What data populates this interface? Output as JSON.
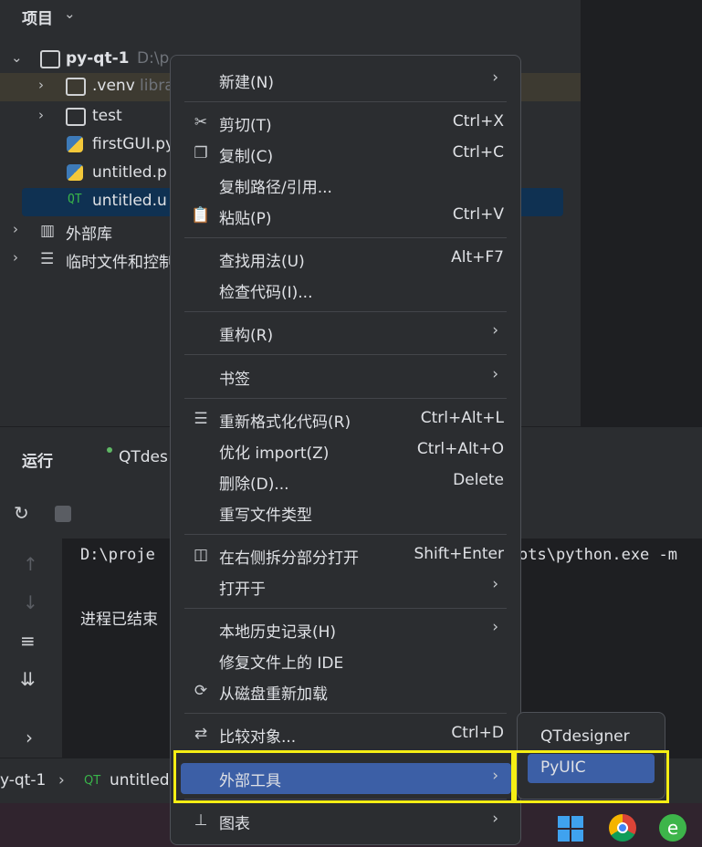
{
  "project_panel": {
    "title": "项目",
    "tree": [
      {
        "label": "py-qt-1",
        "hint": "D:\\p"
      },
      {
        "label": ".venv",
        "hint": "libra"
      },
      {
        "label": "test",
        "hint": ""
      },
      {
        "label": "firstGUI.py",
        "hint": ""
      },
      {
        "label": "untitled.p",
        "hint": ""
      },
      {
        "label": "untitled.u",
        "hint": ""
      },
      {
        "label": "外部库",
        "hint": ""
      },
      {
        "label": "临时文件和控制",
        "hint": ""
      }
    ]
  },
  "run_panel": {
    "title": "运行",
    "tab": "QTdes",
    "console_lines": [
      "D:\\proje",
      "ots\\python.exe -m",
      "进程已结束"
    ]
  },
  "status_bar": {
    "project": "y-qt-1",
    "file": "untitled"
  },
  "context_menu": {
    "items": [
      {
        "label": "新建(N)",
        "shortcut": "",
        "submenu": true
      },
      {
        "label": "剪切(T)",
        "shortcut": "Ctrl+X",
        "submenu": false
      },
      {
        "label": "复制(C)",
        "shortcut": "Ctrl+C",
        "submenu": false
      },
      {
        "label": "复制路径/引用...",
        "shortcut": "",
        "submenu": false
      },
      {
        "label": "粘贴(P)",
        "shortcut": "Ctrl+V",
        "submenu": false
      },
      {
        "label": "查找用法(U)",
        "shortcut": "Alt+F7",
        "submenu": false
      },
      {
        "label": "检查代码(I)...",
        "shortcut": "",
        "submenu": false
      },
      {
        "label": "重构(R)",
        "shortcut": "",
        "submenu": true
      },
      {
        "label": "书签",
        "shortcut": "",
        "submenu": true
      },
      {
        "label": "重新格式化代码(R)",
        "shortcut": "Ctrl+Alt+L",
        "submenu": false
      },
      {
        "label": "优化 import(Z)",
        "shortcut": "Ctrl+Alt+O",
        "submenu": false
      },
      {
        "label": "删除(D)...",
        "shortcut": "Delete",
        "submenu": false
      },
      {
        "label": "重写文件类型",
        "shortcut": "",
        "submenu": false
      },
      {
        "label": "在右侧拆分部分打开",
        "shortcut": "Shift+Enter",
        "submenu": false
      },
      {
        "label": "打开于",
        "shortcut": "",
        "submenu": true
      },
      {
        "label": "本地历史记录(H)",
        "shortcut": "",
        "submenu": true
      },
      {
        "label": "修复文件上的 IDE",
        "shortcut": "",
        "submenu": false
      },
      {
        "label": "从磁盘重新加载",
        "shortcut": "",
        "submenu": false
      },
      {
        "label": "比较对象...",
        "shortcut": "Ctrl+D",
        "submenu": false
      },
      {
        "label": "外部工具",
        "shortcut": "",
        "submenu": true
      },
      {
        "label": "图表",
        "shortcut": "",
        "submenu": true
      }
    ]
  },
  "external_tools_submenu": {
    "items": [
      "QTdesigner",
      "PyUIC"
    ]
  },
  "colors": {
    "highlight": "#3c5fa6",
    "annotation": "#f5ee14"
  }
}
